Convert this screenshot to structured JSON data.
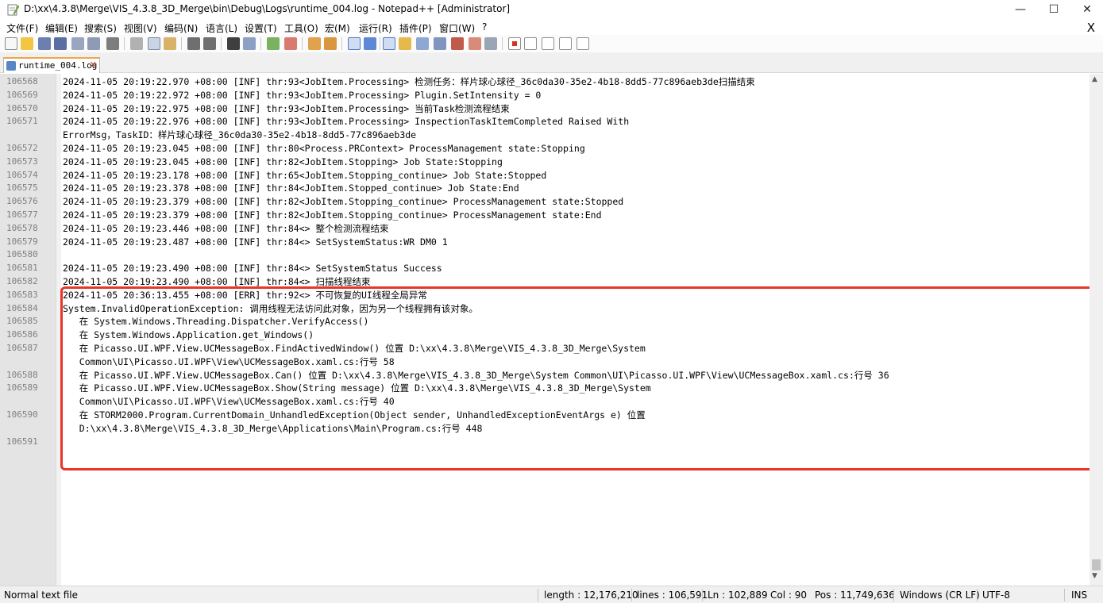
{
  "window": {
    "title": "D:\\xx\\4.3.8\\Merge\\VIS_4.3.8_3D_Merge\\bin\\Debug\\Logs\\runtime_004.log - Notepad++ [Administrator]",
    "minimize_glyph": "—",
    "maximize_glyph": "☐",
    "close_glyph": "✕"
  },
  "menu": {
    "items": [
      "文件(F)",
      "编辑(E)",
      "搜索(S)",
      "视图(V)",
      "编码(N)",
      "语言(L)",
      "设置(T)",
      "工具(O)",
      "宏(M)",
      "运行(R)",
      "插件(P)",
      "窗口(W)",
      "?"
    ],
    "close_glyph": "X"
  },
  "toolbar": {
    "icons": [
      "new-file-icon",
      "open-file-icon",
      "save-icon",
      "save-all-icon",
      "close-icon",
      "close-all-icon",
      "print-icon",
      "cut-icon",
      "copy-icon",
      "paste-icon",
      "undo-icon",
      "redo-icon",
      "find-icon",
      "replace-icon",
      "zoom-in-icon",
      "zoom-out-icon",
      "sync-vertical-icon",
      "sync-horizontal-icon",
      "word-wrap-icon",
      "show-all-chars-icon",
      "indent-guide-icon",
      "udl-icon",
      "doc-map-icon",
      "function-list-icon",
      "folder-workspace-icon",
      "doc-switcher-icon",
      "monitoring-icon",
      "record-macro-icon",
      "stop-record-icon",
      "play-macro-icon",
      "play-multiple-icon",
      "save-macro-icon"
    ]
  },
  "tab": {
    "label": "runtime_004.log",
    "close_glyph": "✕"
  },
  "editor": {
    "lines": [
      {
        "n": "106568",
        "t": "2024-11-05 20:19:22.970 +08:00 [INF] thr:93<JobItem.Processing> 检测任务：样片球心球径_36c0da30-35e2-4b18-8dd5-77c896aeb3de扫描结束"
      },
      {
        "n": "106569",
        "t": "2024-11-05 20:19:22.972 +08:00 [INF] thr:93<JobItem.Processing> Plugin.SetIntensity = 0"
      },
      {
        "n": "106570",
        "t": "2024-11-05 20:19:22.975 +08:00 [INF] thr:93<JobItem.Processing> 当前Task检测流程结束"
      },
      {
        "n": "106571",
        "t": "2024-11-05 20:19:22.976 +08:00 [INF] thr:93<JobItem.Processing> InspectionTaskItemCompleted Raised With"
      },
      {
        "n": "",
        "t": "ErrorMsg，TaskID：样片球心球径_36c0da30-35e2-4b18-8dd5-77c896aeb3de"
      },
      {
        "n": "106572",
        "t": "2024-11-05 20:19:23.045 +08:00 [INF] thr:80<Process.PRContext> ProcessManagement state:Stopping"
      },
      {
        "n": "106573",
        "t": "2024-11-05 20:19:23.045 +08:00 [INF] thr:82<JobItem.Stopping> Job State:Stopping"
      },
      {
        "n": "106574",
        "t": "2024-11-05 20:19:23.178 +08:00 [INF] thr:65<JobItem.Stopping_continue> Job State:Stopped"
      },
      {
        "n": "106575",
        "t": "2024-11-05 20:19:23.378 +08:00 [INF] thr:84<JobItem.Stopped_continue> Job State:End"
      },
      {
        "n": "106576",
        "t": "2024-11-05 20:19:23.379 +08:00 [INF] thr:82<JobItem.Stopping_continue> ProcessManagement state:Stopped"
      },
      {
        "n": "106577",
        "t": "2024-11-05 20:19:23.379 +08:00 [INF] thr:82<JobItem.Stopping_continue> ProcessManagement state:End"
      },
      {
        "n": "106578",
        "t": "2024-11-05 20:19:23.446 +08:00 [INF] thr:84<> 整个检测流程结束"
      },
      {
        "n": "106579",
        "t": "2024-11-05 20:19:23.487 +08:00 [INF] thr:84<> SetSystemStatus:WR DM0 1"
      },
      {
        "n": "106580",
        "t": ""
      },
      {
        "n": "106581",
        "t": "2024-11-05 20:19:23.490 +08:00 [INF] thr:84<> SetSystemStatus Success"
      },
      {
        "n": "106582",
        "t": "2024-11-05 20:19:23.490 +08:00 [INF] thr:84<> 扫描线程结束"
      },
      {
        "n": "106583",
        "t": "2024-11-05 20:36:13.455 +08:00 [ERR] thr:92<> 不可恢复的UI线程全局异常"
      },
      {
        "n": "106584",
        "t": "System.InvalidOperationException: 调用线程无法访问此对象，因为另一个线程拥有该对象。"
      },
      {
        "n": "106585",
        "t": "   在 System.Windows.Threading.Dispatcher.VerifyAccess()"
      },
      {
        "n": "106586",
        "t": "   在 System.Windows.Application.get_Windows()"
      },
      {
        "n": "106587",
        "t": "   在 Picasso.UI.WPF.View.UCMessageBox.FindActivedWindow() 位置 D:\\xx\\4.3.8\\Merge\\VIS_4.3.8_3D_Merge\\System"
      },
      {
        "n": "",
        "t": "   Common\\UI\\Picasso.UI.WPF\\View\\UCMessageBox.xaml.cs:行号 58"
      },
      {
        "n": "106588",
        "t": "   在 Picasso.UI.WPF.View.UCMessageBox.Can() 位置 D:\\xx\\4.3.8\\Merge\\VIS_4.3.8_3D_Merge\\System Common\\UI\\Picasso.UI.WPF\\View\\UCMessageBox.xaml.cs:行号 36"
      },
      {
        "n": "106589",
        "t": "   在 Picasso.UI.WPF.View.UCMessageBox.Show(String message) 位置 D:\\xx\\4.3.8\\Merge\\VIS_4.3.8_3D_Merge\\System"
      },
      {
        "n": "",
        "t": "   Common\\UI\\Picasso.UI.WPF\\View\\UCMessageBox.xaml.cs:行号 40"
      },
      {
        "n": "106590",
        "t": "   在 STORM2000.Program.CurrentDomain_UnhandledException(Object sender, UnhandledExceptionEventArgs e) 位置"
      },
      {
        "n": "",
        "t": "   D:\\xx\\4.3.8\\Merge\\VIS_4.3.8_3D_Merge\\Applications\\Main\\Program.cs:行号 448"
      },
      {
        "n": "106591",
        "t": ""
      }
    ]
  },
  "status": {
    "file_type": "Normal text file",
    "length": "length : 12,176,210",
    "lines": "lines : 106,591",
    "ln": "Ln : 102,889",
    "col": "Col : 90",
    "pos": "Pos : 11,749,636",
    "eol": "Windows (CR LF)",
    "encoding": "UTF-8",
    "mode": "INS"
  },
  "colors": {
    "highlight_border": "#e8362a",
    "tab_accent": "#f5a447"
  }
}
